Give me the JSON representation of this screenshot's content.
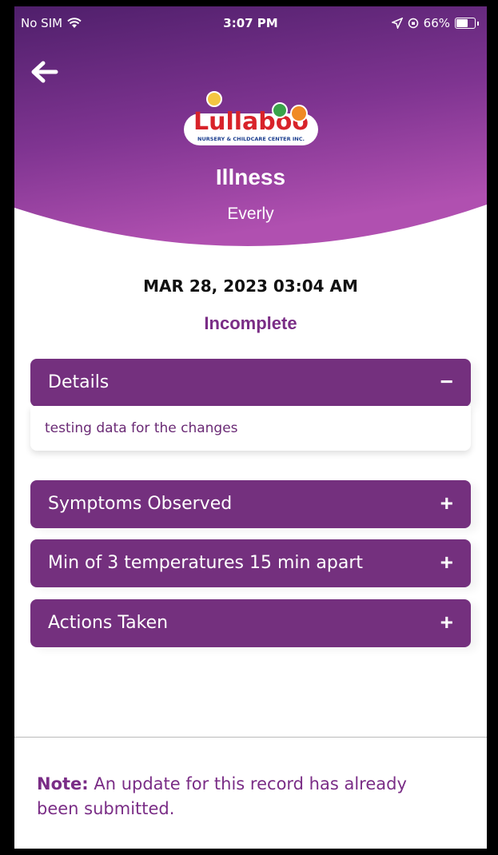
{
  "status_bar": {
    "carrier": "No SIM",
    "time": "3:07 PM",
    "battery_text": "66%",
    "battery_level": 0.66
  },
  "header": {
    "logo_text": "Lullaboo",
    "logo_subtext": "NURSERY & CHILDCARE CENTER INC.",
    "title": "Illness",
    "child_name": "Everly"
  },
  "record": {
    "datetime": "MAR 28, 2023 03:04 AM",
    "status": "Incomplete"
  },
  "sections": [
    {
      "label": "Details",
      "toggle": "−",
      "expanded": true,
      "content": "testing data for the changes"
    },
    {
      "label": "Symptoms Observed",
      "toggle": "+",
      "expanded": false
    },
    {
      "label": "Min of 3 temperatures 15 min apart",
      "toggle": "+",
      "expanded": false
    },
    {
      "label": "Actions Taken",
      "toggle": "+",
      "expanded": false
    }
  ],
  "note": {
    "prefix": "Note:",
    "text": " An update for this record has already been submitted."
  },
  "colors": {
    "primary": "#74307e",
    "header_gradient_top": "#5d2274",
    "header_gradient_bottom": "#a64aa6",
    "status_text": "#7a2d86"
  }
}
